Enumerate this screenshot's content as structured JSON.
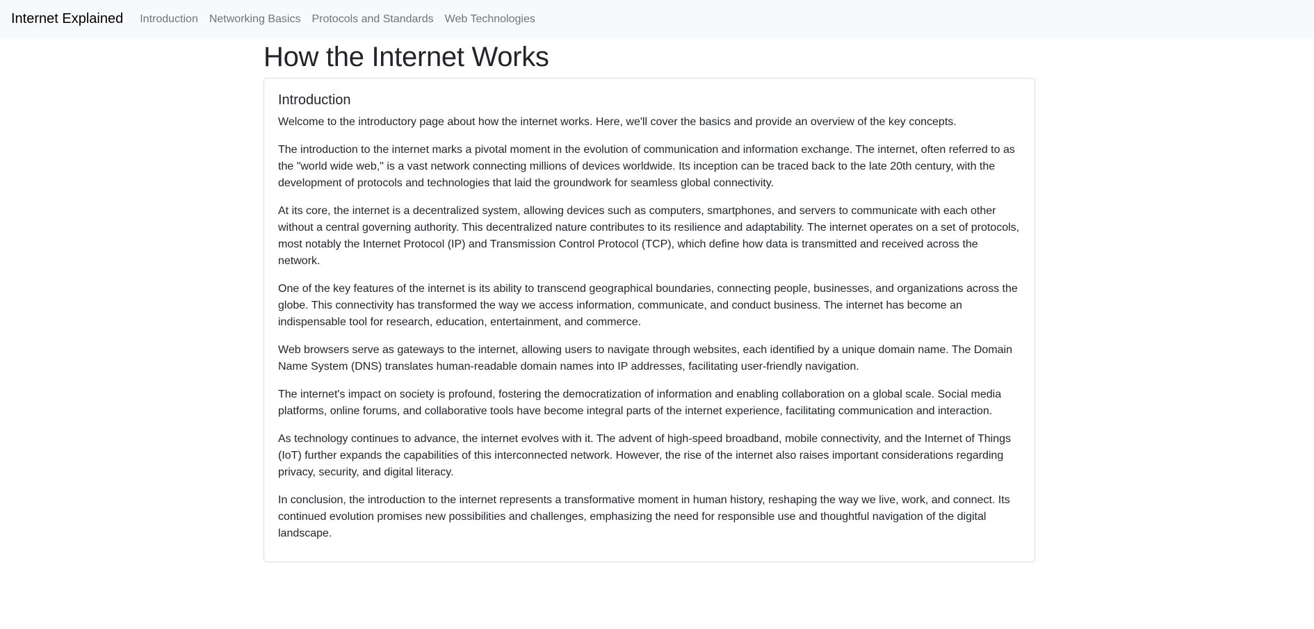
{
  "navbar": {
    "brand": "Internet Explained",
    "links": [
      {
        "label": "Introduction"
      },
      {
        "label": "Networking Basics"
      },
      {
        "label": "Protocols and Standards"
      },
      {
        "label": "Web Technologies"
      }
    ]
  },
  "main": {
    "title": "How the Internet Works",
    "card": {
      "title": "Introduction",
      "paragraphs": [
        "Welcome to the introductory page about how the internet works. Here, we'll cover the basics and provide an overview of the key concepts.",
        "The introduction to the internet marks a pivotal moment in the evolution of communication and information exchange. The internet, often referred to as the \"world wide web,\" is a vast network connecting millions of devices worldwide. Its inception can be traced back to the late 20th century, with the development of protocols and technologies that laid the groundwork for seamless global connectivity.",
        "At its core, the internet is a decentralized system, allowing devices such as computers, smartphones, and servers to communicate with each other without a central governing authority. This decentralized nature contributes to its resilience and adaptability. The internet operates on a set of protocols, most notably the Internet Protocol (IP) and Transmission Control Protocol (TCP), which define how data is transmitted and received across the network.",
        "One of the key features of the internet is its ability to transcend geographical boundaries, connecting people, businesses, and organizations across the globe. This connectivity has transformed the way we access information, communicate, and conduct business. The internet has become an indispensable tool for research, education, entertainment, and commerce.",
        "Web browsers serve as gateways to the internet, allowing users to navigate through websites, each identified by a unique domain name. The Domain Name System (DNS) translates human-readable domain names into IP addresses, facilitating user-friendly navigation.",
        "The internet's impact on society is profound, fostering the democratization of information and enabling collaboration on a global scale. Social media platforms, online forums, and collaborative tools have become integral parts of the internet experience, facilitating communication and interaction.",
        "As technology continues to advance, the internet evolves with it. The advent of high-speed broadband, mobile connectivity, and the Internet of Things (IoT) further expands the capabilities of this interconnected network. However, the rise of the internet also raises important considerations regarding privacy, security, and digital literacy.",
        "In conclusion, the introduction to the internet represents a transformative moment in human history, reshaping the way we live, work, and connect. Its continued evolution promises new possibilities and challenges, emphasizing the need for responsible use and thoughtful navigation of the digital landscape."
      ]
    }
  }
}
